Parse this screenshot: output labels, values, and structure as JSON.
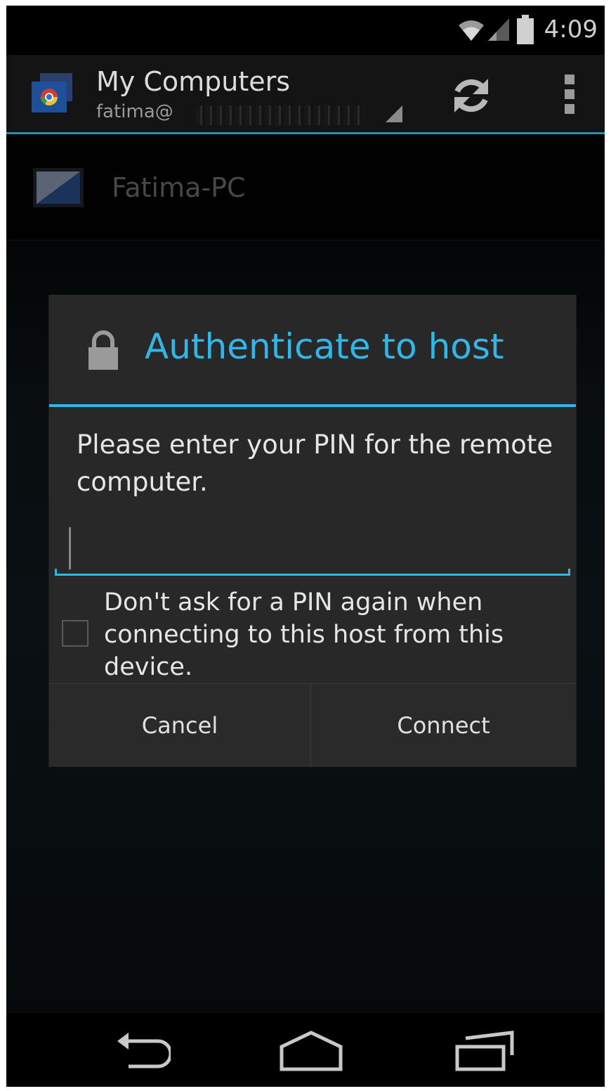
{
  "status_bar": {
    "time": "4:09",
    "icons": [
      "wifi-icon",
      "signal-icon",
      "battery-icon"
    ]
  },
  "action_bar": {
    "title": "My Computers",
    "account": "fatima@",
    "icons": [
      "chrome-remote-desktop-icon",
      "refresh-icon",
      "overflow-menu-icon"
    ]
  },
  "host_list": [
    {
      "name": "Fatima-PC",
      "icon": "monitor-icon"
    }
  ],
  "dialog": {
    "title": "Authenticate to host",
    "message": "Please enter your PIN for the remote computer.",
    "pin_value": "",
    "checkbox_label": "Don't ask for a PIN again when connecting to this host from this device.",
    "checkbox_checked": false,
    "cancel_label": "Cancel",
    "connect_label": "Connect"
  },
  "nav_bar": {
    "icons": [
      "back-icon",
      "home-icon",
      "recents-icon"
    ]
  },
  "colors": {
    "accent": "#33b5e5",
    "background": "#000000",
    "dialog": "#282828"
  }
}
